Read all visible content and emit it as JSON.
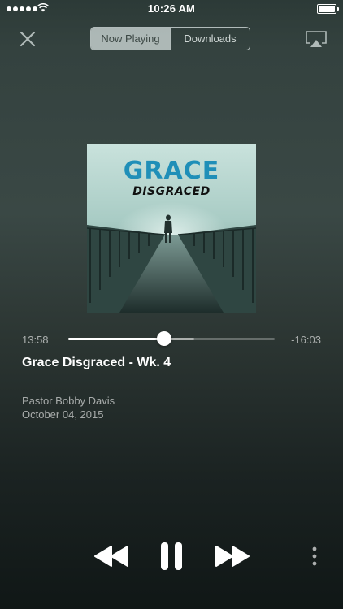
{
  "status_bar": {
    "time": "10:26 AM",
    "signal_icon": "signal-dots-icon",
    "wifi_icon": "wifi-icon",
    "battery_icon": "battery-icon",
    "battery_level": 1.0
  },
  "header": {
    "close_icon": "close-icon",
    "tabs": [
      {
        "label": "Now Playing",
        "active": true
      },
      {
        "label": "Downloads",
        "active": false
      }
    ],
    "airplay_icon": "airplay-icon"
  },
  "artwork": {
    "title": "GRACE",
    "subtitle": "DISGRACED",
    "title_color": "#1f8fb8"
  },
  "player": {
    "elapsed": "13:58",
    "remaining": "-16:03",
    "progress": 0.465,
    "buffered": 0.61
  },
  "track": {
    "title": "Grace Disgraced - Wk. 4",
    "speaker": "Pastor Bobby Davis",
    "date": "October 04, 2015"
  },
  "controls": {
    "rewind_icon": "rewind-icon",
    "pause_icon": "pause-icon",
    "forward_icon": "fast-forward-icon",
    "more_icon": "more-vertical-icon"
  },
  "colors": {
    "accent": "#1f8fb8",
    "background_top": "#34423f",
    "background_bottom": "#101716"
  }
}
